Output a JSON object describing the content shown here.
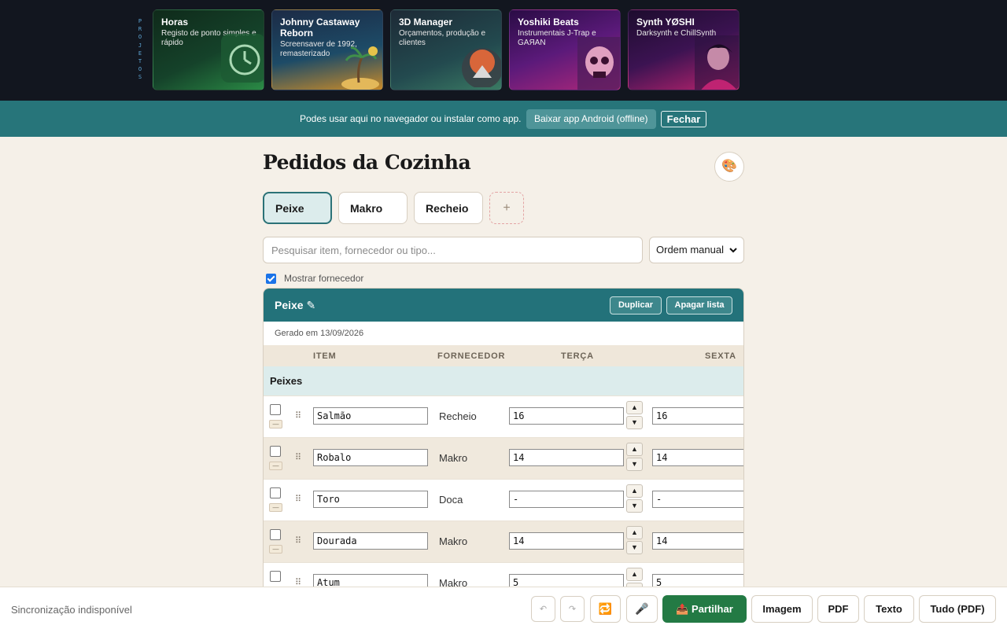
{
  "projects": {
    "label": "PROJETOS",
    "cards": [
      {
        "title": "Horas",
        "subtitle": "Registo de ponto simples e rápido"
      },
      {
        "title": "Johnny Castaway Reborn",
        "subtitle": "Screensaver de 1992, remasterizado"
      },
      {
        "title": "3D Manager",
        "subtitle": "Orçamentos, produção e clientes"
      },
      {
        "title": "Yoshiki Beats",
        "subtitle": "Instrumentais J-Trap e GAЯAN"
      },
      {
        "title": "Synth YØSHI",
        "subtitle": "Darksynth e ChillSynth"
      }
    ]
  },
  "banner": {
    "text": "Podes usar aqui no navegador ou instalar como app.",
    "android_label": "Baixar app Android (offline)",
    "close_label": "Fechar"
  },
  "page": {
    "title": "Pedidos da Cozinha",
    "theme_icon": "🎨"
  },
  "tabs": [
    {
      "label": "Peixe",
      "active": true
    },
    {
      "label": "Makro",
      "active": false
    },
    {
      "label": "Recheio",
      "active": false
    }
  ],
  "add_tab_label": "+",
  "search": {
    "placeholder": "Pesquisar item, fornecedor ou tipo..."
  },
  "order_select": {
    "value": "Ordem manual"
  },
  "show_supplier": {
    "label": "Mostrar fornecedor",
    "checked": true
  },
  "list": {
    "title": "Peixe ✎",
    "duplicate_label": "Duplicar",
    "delete_label": "Apagar lista",
    "generated": "Gerado em 13/09/2026",
    "columns": {
      "item": "ITEM",
      "supplier": "FORNECEDOR",
      "day1": "TERÇA",
      "day2": "SEXTA"
    },
    "group": "Peixes",
    "minus_glyph": "—",
    "grip_glyph": "⠿",
    "up_glyph": "▲",
    "down_glyph": "▼",
    "rows": [
      {
        "item": "Salmão",
        "supplier": "Recheio",
        "day1": "16",
        "day2": "16"
      },
      {
        "item": "Robalo",
        "supplier": "Makro",
        "day1": "14",
        "day2": "14"
      },
      {
        "item": "Toro",
        "supplier": "Doca",
        "day1": "-",
        "day2": "-"
      },
      {
        "item": "Dourada",
        "supplier": "Makro",
        "day1": "14",
        "day2": "14"
      },
      {
        "item": "Atum",
        "supplier": "Makro",
        "day1": "5",
        "day2": "5"
      }
    ]
  },
  "footer": {
    "sync_status": "Sincronização indisponível",
    "undo_icon": "↶",
    "redo_icon": "↷",
    "repeat_icon": "🔁",
    "mic_icon": "🎤",
    "share_label": "📤 Partilhar",
    "image_label": "Imagem",
    "pdf_label": "PDF",
    "text_label": "Texto",
    "all_pdf_label": "Tudo (PDF)"
  },
  "colors": {
    "teal": "#23727a",
    "banner": "#27757a",
    "share_green": "#237a44",
    "background": "#f5f0e8"
  }
}
